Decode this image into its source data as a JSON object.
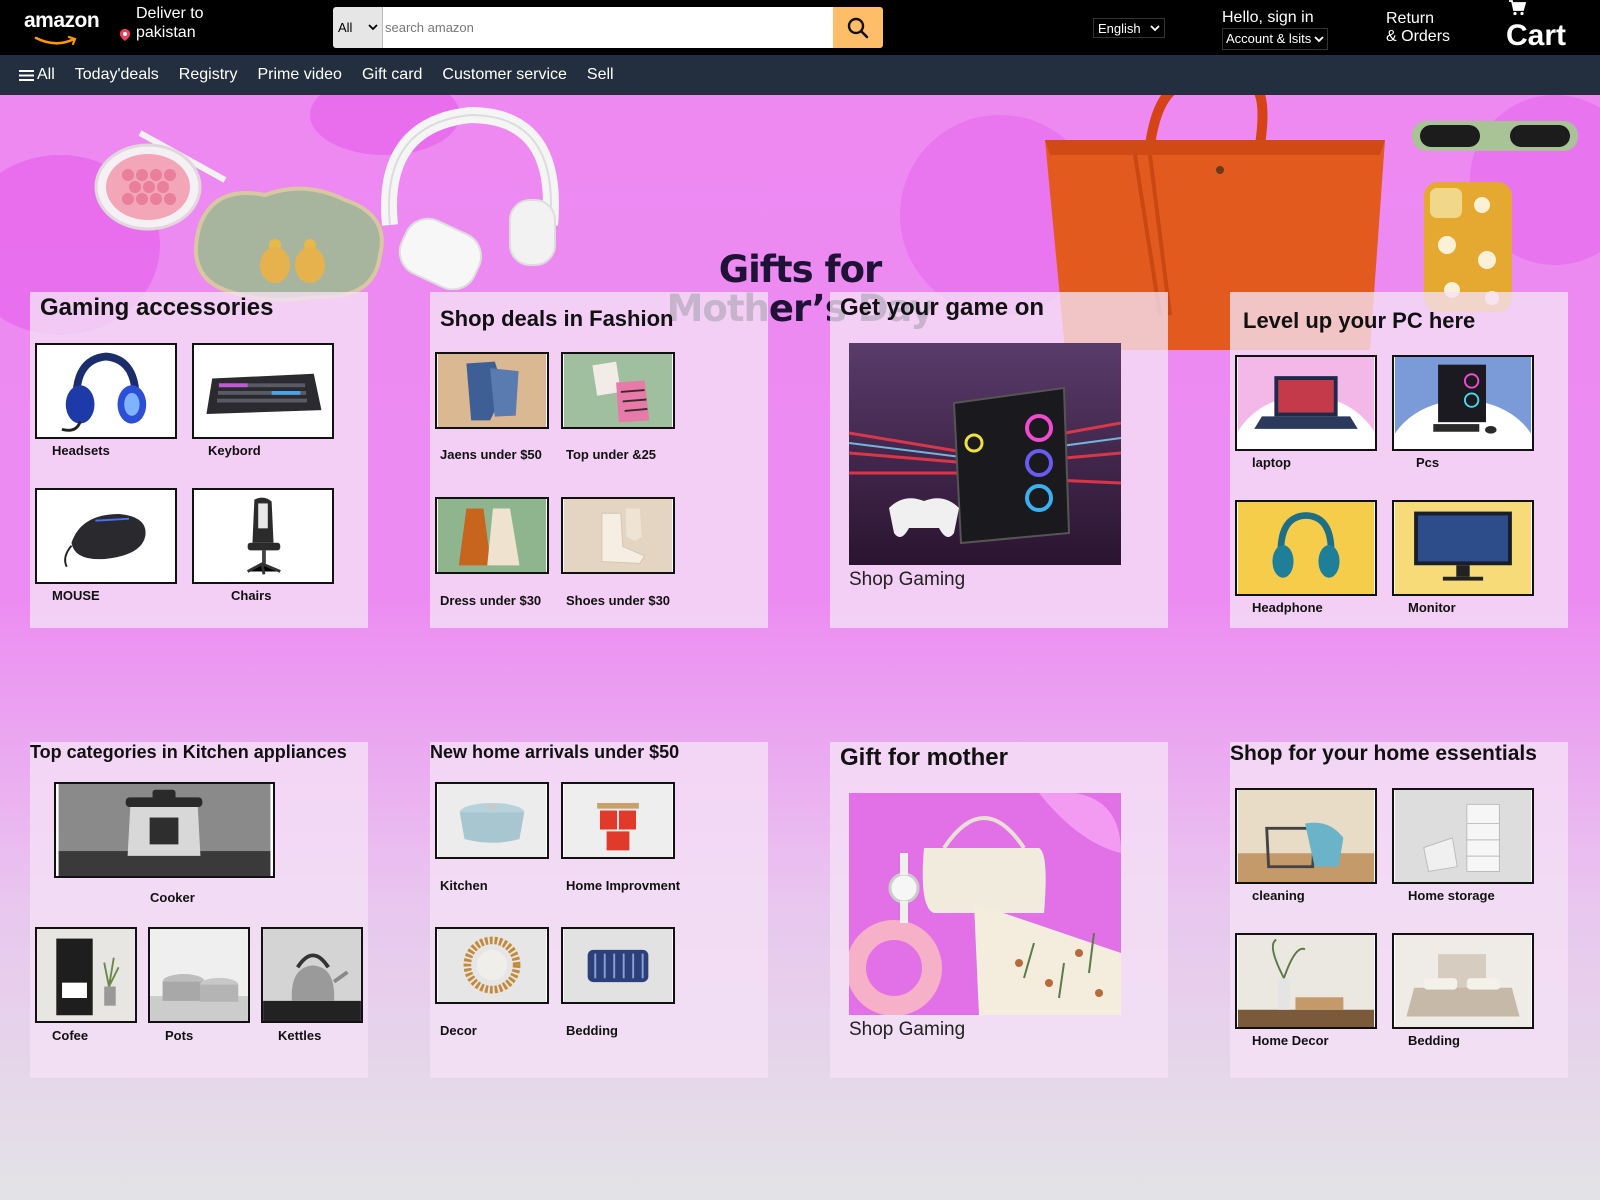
{
  "header": {
    "logo_text": "amazon",
    "deliver_line1": "Deliver to",
    "deliver_line2": "pakistan",
    "search_category": "All",
    "search_placeholder": "search amazon",
    "language": "English",
    "signin_line1": "Hello, sign in",
    "signin_line2": "Account & lsits",
    "orders_line1": "Return",
    "orders_line2": "& Orders",
    "cart_label": "Cart"
  },
  "nav": {
    "all": "All",
    "items": [
      "Today'deals",
      "Registry",
      "Prime video",
      "Gift card",
      "Customer service",
      "Sell"
    ]
  },
  "hero": {
    "line1": "Gifts for",
    "line2": "Mother’s Day"
  },
  "cards": {
    "gaming": {
      "title": "Gaming accessories",
      "items": [
        "Headsets",
        "Keybord",
        "MOUSE",
        "Chairs"
      ]
    },
    "fashion": {
      "title": "Shop deals in Fashion",
      "items": [
        "Jaens under $50",
        "Top under &25",
        "Dress under $30",
        "Shoes under $30"
      ]
    },
    "game_on": {
      "title": "Get your game on",
      "link": "Shop Gaming"
    },
    "pc": {
      "title": "Level up your PC here",
      "items": [
        "laptop",
        "Pcs",
        "Headphone",
        "Monitor"
      ]
    },
    "kitchen": {
      "title": "Top categories in Kitchen appliances",
      "items": [
        "Cooker",
        "Cofee",
        "Pots",
        "Kettles"
      ]
    },
    "home_new": {
      "title": "New home arrivals under $50",
      "items": [
        "Kitchen",
        "Home Improvment",
        "Decor",
        "Bedding"
      ]
    },
    "mother": {
      "title": "Gift for mother",
      "link": "Shop Gaming"
    },
    "essentials": {
      "title": "Shop for your home essentials",
      "items": [
        "cleaning",
        "Home storage",
        "Home Decor",
        "Bedding"
      ]
    }
  },
  "colors": {
    "header_bg": "#000000",
    "nav_bg": "#232f3e",
    "search_button": "#febd69",
    "hero_pink": "#ee88f2"
  },
  "icons": [
    "location-pin-icon",
    "search-icon",
    "hamburger-icon",
    "cart-icon",
    "chevron-down-icon"
  ]
}
